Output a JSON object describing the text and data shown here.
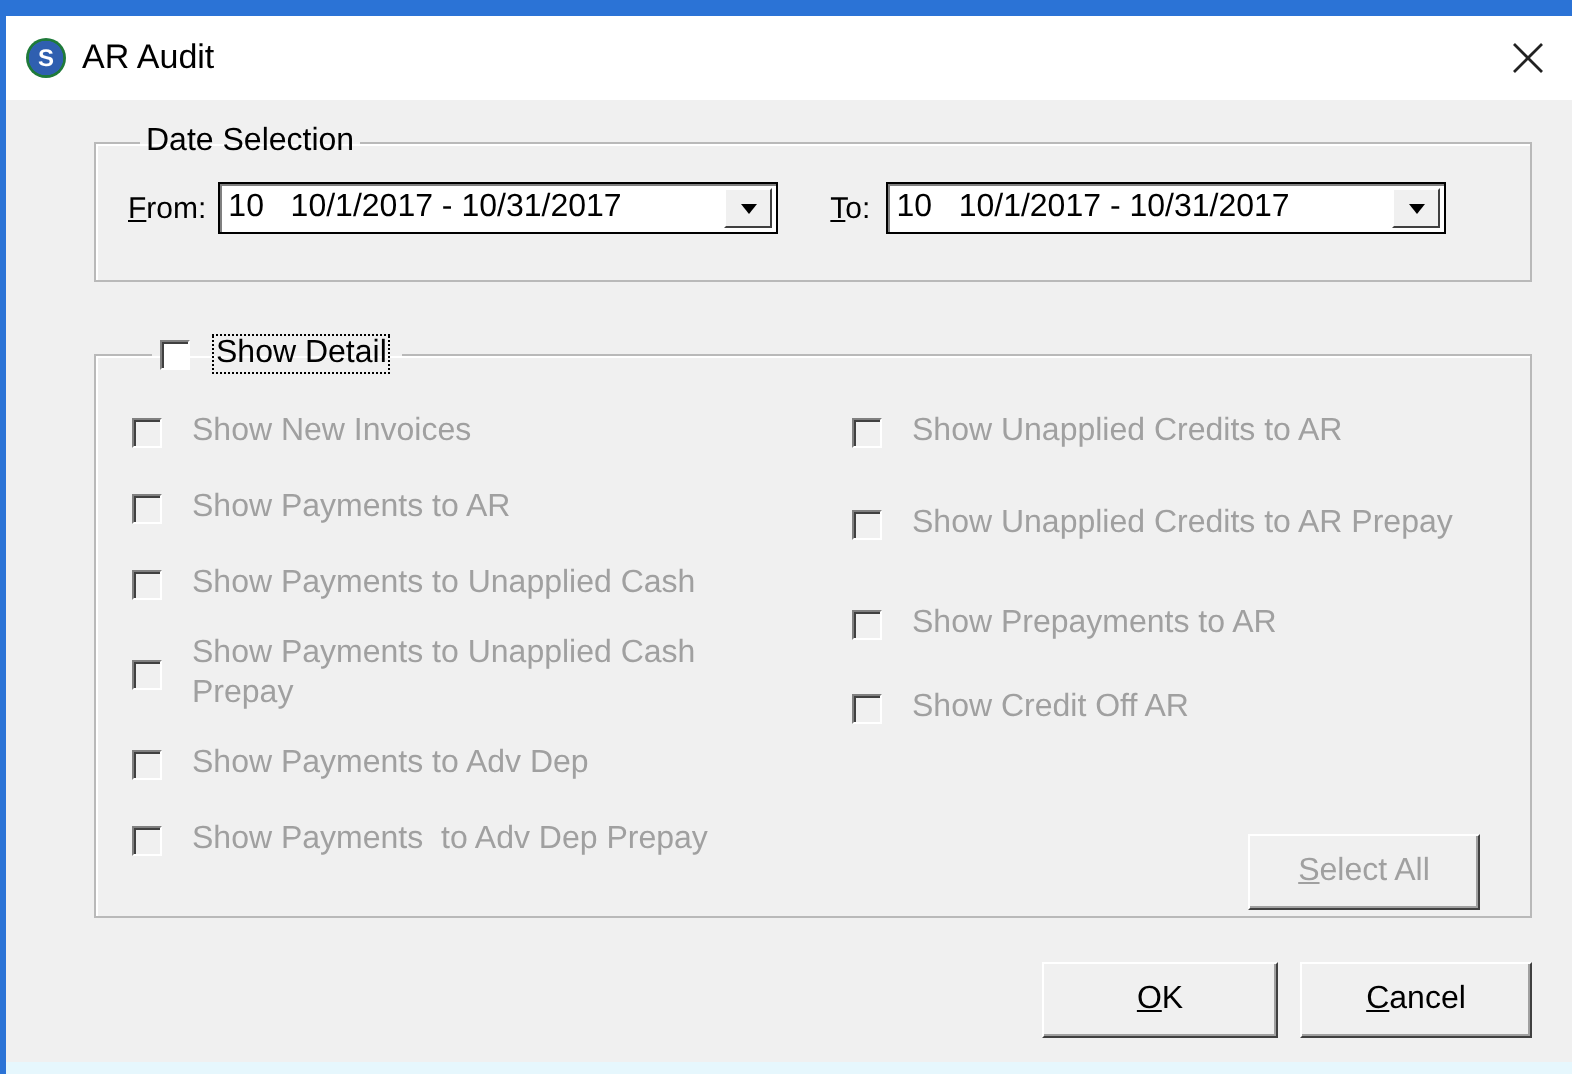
{
  "window": {
    "title": "AR Audit",
    "logo_letter": "S"
  },
  "date_selection": {
    "title": "Date Selection",
    "from": {
      "label": {
        "accel": "F",
        "rest": "rom:"
      },
      "value": "10   10/1/2017 - 10/31/2017"
    },
    "to": {
      "label": {
        "accel": "T",
        "rest": "o:"
      },
      "value": "10   10/1/2017 - 10/31/2017"
    }
  },
  "show_detail": {
    "label": "Show Detail",
    "checked": false,
    "focused": true
  },
  "options_left": [
    {
      "label": "Show New Invoices",
      "checked": false,
      "disabled": true
    },
    {
      "label": "Show Payments to AR",
      "checked": false,
      "disabled": true
    },
    {
      "label": "Show Payments to Unapplied Cash",
      "checked": false,
      "disabled": true
    },
    {
      "label": "Show Payments to Unapplied Cash Prepay",
      "checked": false,
      "disabled": true
    },
    {
      "label": "Show Payments to Adv Dep",
      "checked": false,
      "disabled": true
    },
    {
      "label": "Show Payments  to Adv Dep Prepay",
      "checked": false,
      "disabled": true
    }
  ],
  "options_right": [
    {
      "label": "Show Unapplied Credits to AR",
      "checked": false,
      "disabled": true
    },
    {
      "label": "Show Unapplied Credits to AR Prepay",
      "checked": false,
      "disabled": true
    },
    {
      "label": "Show Prepayments to AR",
      "checked": false,
      "disabled": true
    },
    {
      "label": "Show Credit Off AR",
      "checked": false,
      "disabled": true
    }
  ],
  "select_all": {
    "label": {
      "accel": "S",
      "rest": "elect All"
    },
    "disabled": true
  },
  "buttons": [
    {
      "accel": "O",
      "rest": "K"
    },
    {
      "accel": "C",
      "rest": "ancel"
    }
  ]
}
